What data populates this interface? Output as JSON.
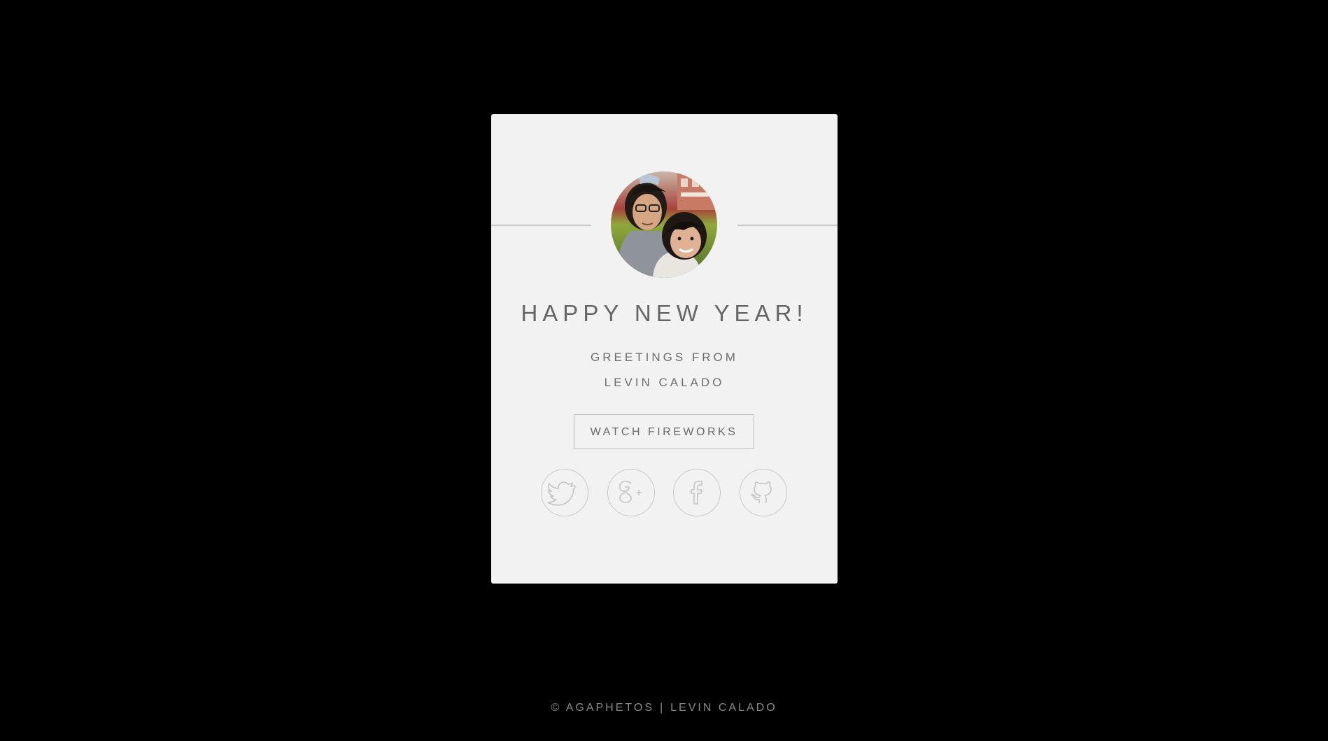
{
  "card": {
    "title": "HAPPY NEW YEAR!",
    "greeting_line1": "GREETINGS FROM",
    "greeting_line2": "LEVIN CALADO",
    "button_label": "WATCH FIREWORKS",
    "avatar_alt": "photo-avatar"
  },
  "social": [
    {
      "icon": "twitter-icon"
    },
    {
      "icon": "google-plus-icon"
    },
    {
      "icon": "facebook-icon"
    },
    {
      "icon": "github-icon"
    }
  ],
  "footer": {
    "copyright": "© AGAPHETOS",
    "separator": "|",
    "author": "LEVIN CALADO"
  },
  "colors": {
    "background": "#000000",
    "card": "#f2f2f2",
    "text": "#666666",
    "icon_stroke": "#c9c9c9"
  }
}
